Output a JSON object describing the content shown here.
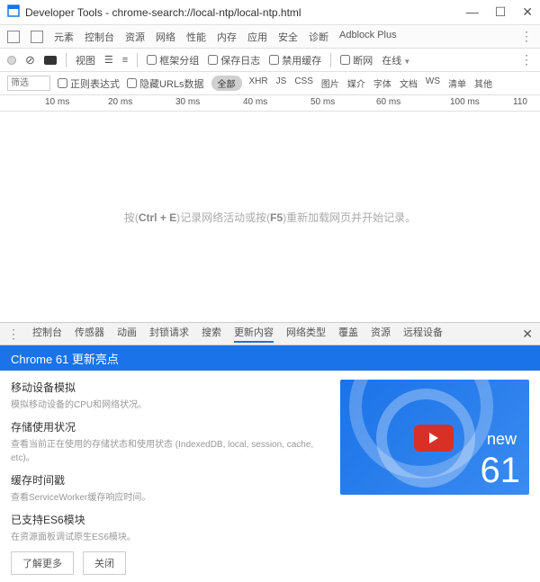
{
  "window": {
    "title": "Developer Tools - chrome-search://local-ntp/local-ntp.html"
  },
  "mainTabs": [
    "元素",
    "控制台",
    "资源",
    "网络",
    "性能",
    "内存",
    "应用",
    "安全",
    "诊断",
    "Adblock Plus"
  ],
  "toolbar2": {
    "view": "视图",
    "frameGroup": "框架分组",
    "preserveLog": "保存日志",
    "disableCache": "禁用缓存",
    "offline": "断网",
    "online": "在线"
  },
  "filter": {
    "placeholder": "筛选",
    "regex": "正则表达式",
    "hideDataUrls": "隐藏URLs数据",
    "all": "全部",
    "types": [
      "XHR",
      "JS",
      "CSS",
      "图片",
      "媒介",
      "字体",
      "文档",
      "WS",
      "清单",
      "其他"
    ]
  },
  "timeline": {
    "ticks": [
      "10 ms",
      "20 ms",
      "30 ms",
      "40 ms",
      "50 ms",
      "60 ms",
      "100 ms",
      "110"
    ]
  },
  "netEmpty": {
    "pre": "按(",
    "k1": "Ctrl + E",
    "mid": ")记录网络活动或按(",
    "k2": "F5",
    "post": ")重新加载网页并开始记录。"
  },
  "drawerTabs": [
    "控制台",
    "传感器",
    "动画",
    "封锁请求",
    "搜索",
    "更新内容",
    "网络类型",
    "覆盖",
    "资源",
    "远程设备"
  ],
  "drawerActiveIndex": 5,
  "banner": "Chrome 61 更新亮点",
  "whatsnew": {
    "items": [
      {
        "title": "移动设备模拟",
        "desc": "模拟移动设备的CPU和网络状况。"
      },
      {
        "title": "存储使用状况",
        "desc": "查看当前正在使用的存储状态和使用状态 (IndexedDB, local, session, cache, etc)。"
      },
      {
        "title": "缓存时间戳",
        "desc": "查看ServiceWorker缓存响应时间。"
      },
      {
        "title": "已支持ES6模块",
        "desc": "在资源面板调试原生ES6模块。"
      }
    ],
    "actions": {
      "learnMore": "了解更多",
      "close": "关闭"
    },
    "promo": {
      "new": "new",
      "num": "61"
    }
  }
}
